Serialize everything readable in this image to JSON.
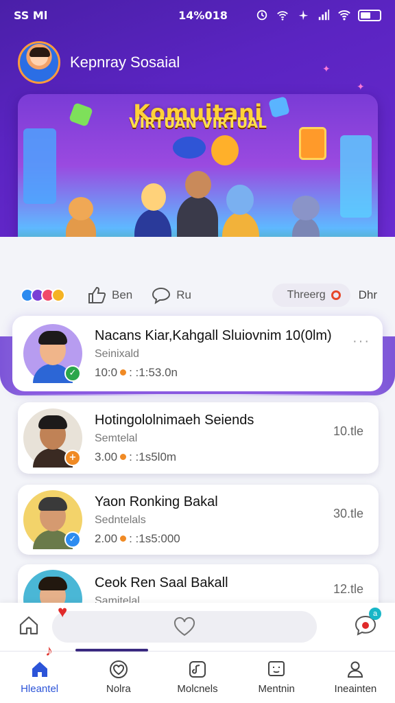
{
  "status_bar": {
    "carrier": "SS Ml",
    "time": "14%018"
  },
  "header": {
    "profile_name": "Kepnray Sosaial"
  },
  "banner": {
    "title": "Komuitani",
    "subtitle": "VIRTUAN VIRTUAL"
  },
  "actions": {
    "reaction_colors": [
      "#2d8cf0",
      "#7a3fd6",
      "#f04a6a",
      "#f5b323"
    ],
    "like_label": "Ben",
    "comment_label": "Ru",
    "trend_label": "Threerg",
    "more_label": "Dhr"
  },
  "cards": [
    {
      "title": "Nacans Kiar,Kahgall Sluiovnim 10(0lm)",
      "subtitle": "Seinixald",
      "meta_left": "10:0",
      "meta_right": ": :1:53.0n",
      "right": "···",
      "badge_icon": "check-icon",
      "badge_color": "#2aa64a",
      "avatar_bg": "#b79cf0"
    },
    {
      "title": "Hotingololnimaeh Seiends",
      "subtitle": "Semtelal",
      "meta_left": "3.00",
      "meta_right": ": :1s5l0m",
      "right": "10.tle",
      "badge_icon": "plus-icon",
      "badge_color": "#f08a24",
      "avatar_bg": "#e8e2d8"
    },
    {
      "title": "Yaon Ronking Bakal",
      "subtitle": "Sedntelals",
      "meta_left": "2.00",
      "meta_right": ": :1s5:000",
      "right": "30.tle",
      "badge_icon": "check-icon",
      "badge_color": "#2d8cf0",
      "avatar_bg": "#f3d36a"
    },
    {
      "title": "Ceok Ren Saal Bakall",
      "subtitle": "Samitelal",
      "right": "12.tle",
      "avatar_bg": "#4ab7d6"
    }
  ],
  "bottom": {
    "chat_badge": "a"
  },
  "tabs": [
    {
      "label": "Hleantel",
      "icon": "home-icon",
      "active": true
    },
    {
      "label": "Nolra",
      "icon": "heart-icon",
      "active": false
    },
    {
      "label": "Molcnels",
      "icon": "media-icon",
      "active": false
    },
    {
      "label": "Mentnin",
      "icon": "message-icon",
      "active": false
    },
    {
      "label": "Ineainten",
      "icon": "user-icon",
      "active": false
    }
  ],
  "colors": {
    "header_purple": "#5b24c2",
    "accent_blue": "#2c54d8",
    "alert_red": "#e02a2a"
  }
}
